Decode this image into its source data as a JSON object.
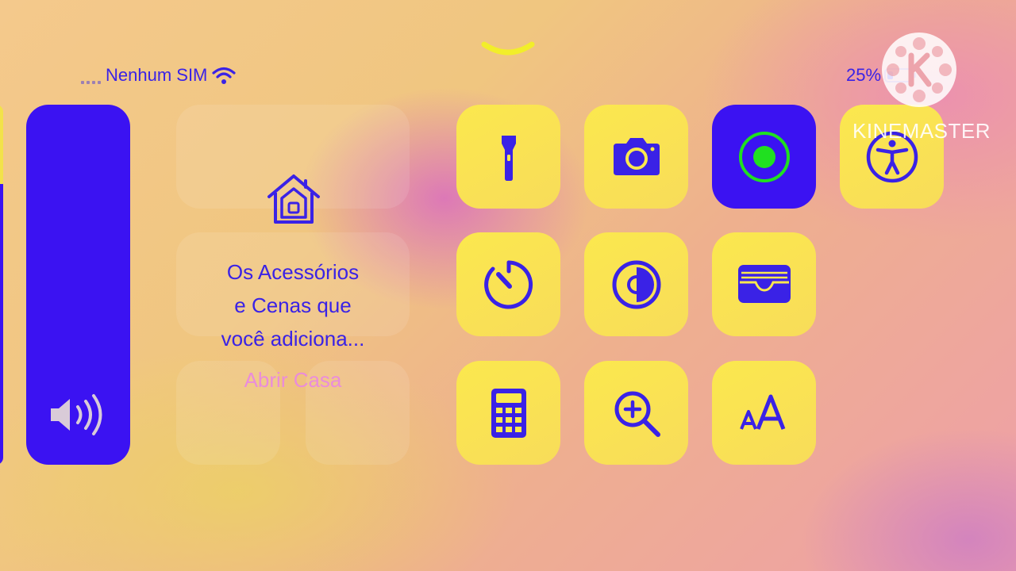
{
  "status_bar": {
    "carrier": "Nenhum SIM",
    "battery_percent": "25%",
    "battery_level": 0.25,
    "icons": [
      "signal-icon",
      "wifi-icon",
      "battery-icon"
    ]
  },
  "sliders": {
    "volume_icon": "speaker-icon"
  },
  "home_module": {
    "description": "Os Acessórios e Cenas que você adiciona...",
    "description_lines": [
      "Os Acessórios",
      "e Cenas que",
      "você adiciona..."
    ],
    "open_label": "Abrir Casa",
    "icon": "home-icon"
  },
  "controls": [
    {
      "name": "flashlight",
      "icon": "flashlight-icon",
      "active": false
    },
    {
      "name": "camera",
      "icon": "camera-icon",
      "active": false
    },
    {
      "name": "screen-recording",
      "icon": "record-icon",
      "active": true
    },
    {
      "name": "accessibility",
      "icon": "accessibility-icon",
      "active": false
    },
    {
      "name": "timer",
      "icon": "timer-icon",
      "active": false
    },
    {
      "name": "dark-mode",
      "icon": "contrast-icon",
      "active": false
    },
    {
      "name": "wallet",
      "icon": "wallet-icon",
      "active": false
    },
    {
      "name": "calculator",
      "icon": "calculator-icon",
      "active": false
    },
    {
      "name": "magnifier",
      "icon": "magnifier-icon",
      "active": false
    },
    {
      "name": "text-size",
      "icon": "text-size-icon",
      "active": false,
      "label": "AA"
    }
  ],
  "watermark": {
    "text": "KINEMASTER",
    "logo_letter": "K"
  },
  "colors": {
    "accent_blue": "#3b12f2",
    "tile_yellow": "#fbe84e",
    "record_green": "#20e020",
    "link_pink": "#ea86e4"
  }
}
